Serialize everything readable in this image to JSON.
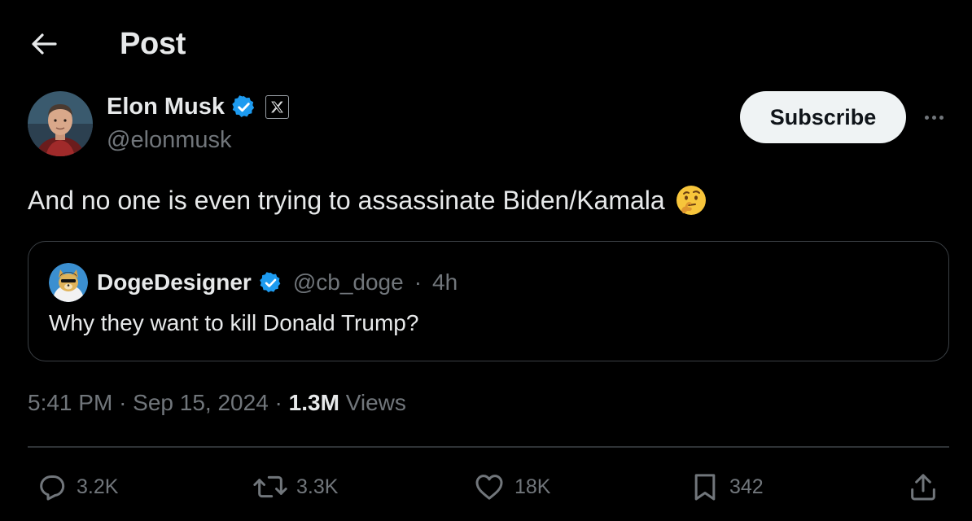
{
  "header": {
    "title": "Post"
  },
  "author": {
    "name": "Elon Musk",
    "handle": "@elonmusk",
    "subscribe_label": "Subscribe",
    "verified_color": "#1d9bf0"
  },
  "post": {
    "text": "And no one is even trying to assassinate Biden/Kamala",
    "emoji": "thinking-face"
  },
  "quote": {
    "name": "DogeDesigner",
    "handle": "@cb_doge",
    "separator": "·",
    "age": "4h",
    "text": "Why they want to kill Donald Trump?"
  },
  "meta": {
    "time": "5:41 PM",
    "date": "Sep 15, 2024",
    "views_count": "1.3M",
    "views_label": "Views"
  },
  "actions": {
    "replies": "3.2K",
    "reposts": "3.3K",
    "likes": "18K",
    "bookmarks": "342"
  },
  "colors": {
    "background": "#000000",
    "text": "#e7e9ea",
    "muted": "#71767b",
    "accent": "#1d9bf0",
    "border": "#2f3336"
  }
}
